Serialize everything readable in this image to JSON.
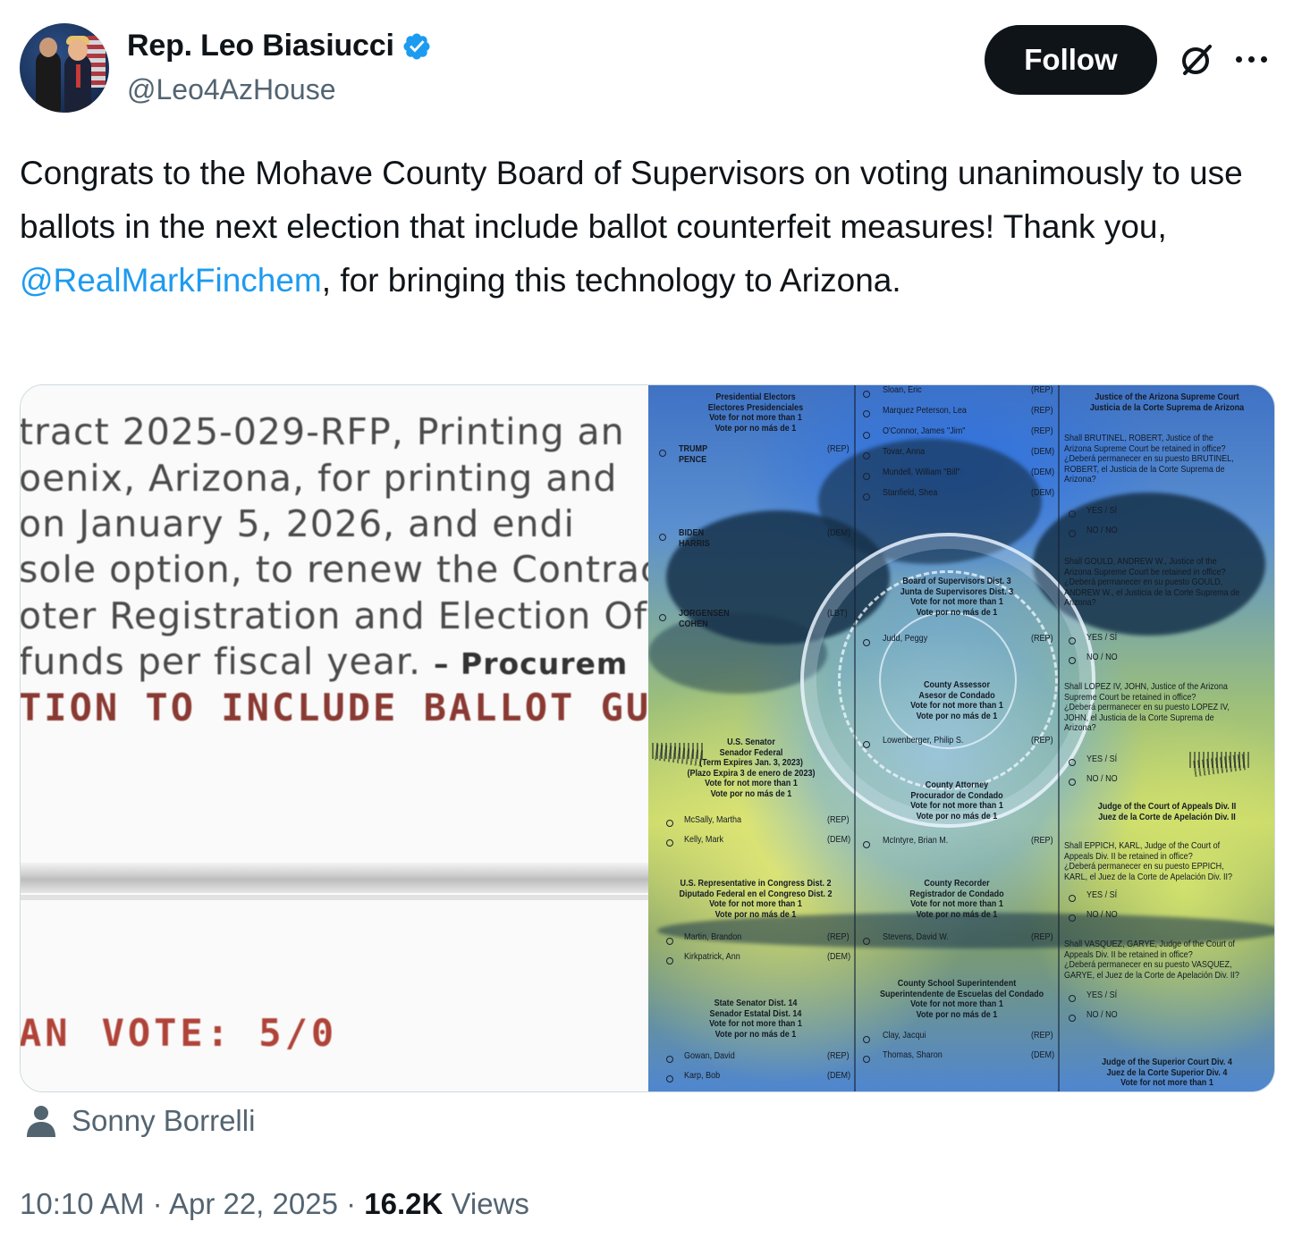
{
  "author": {
    "name": "Rep. Leo Biasiucci",
    "handle": "@Leo4AzHouse",
    "verified_color": "#1d9bf0"
  },
  "actions": {
    "follow_label": "Follow",
    "grok_icon": "grok-icon",
    "more_icon": "more-icon"
  },
  "tweet": {
    "text_before": "Congrats to the Mohave County Board of Supervisors on voting unanimously to use ballots in the next election that include ballot counterfeit measures! Thank you, ",
    "mention": "@RealMarkFinchem",
    "text_after": ", for bringing this technology to Arizona."
  },
  "media": {
    "document_lines": [
      "tract 2025-029-RFP, Printing an",
      "oenix, Arizona, for printing and",
      " on January 5, 2026, and endi",
      "sole option, to renew the Contrac",
      "oter Registration and Election Off",
      " funds per fiscal year."
    ],
    "document_procurement": "– Procurem",
    "document_heading": "TION TO INCLUDE BALLOT GU",
    "document_vote_left": "AN",
    "document_vote": "VOTE: 5/0",
    "ballot": {
      "col1": {
        "h1": [
          "Presidential Electors",
          "Electores Presidenciales",
          "Vote for not more than 1",
          "Vote por no más de 1"
        ],
        "r1": [
          "TRUMP",
          "PENCE"
        ],
        "r1p": "(REP)",
        "r2": [
          "BIDEN",
          "HARRIS"
        ],
        "r2p": "(DEM)",
        "r3": [
          "JORGENSEN",
          "COHEN"
        ],
        "r3p": "(LBT)",
        "h2": [
          "U.S. Senator",
          "Senador Federal",
          "(Term Expires Jan. 3, 2023)",
          "(Plazo Expira 3 de enero de 2023)",
          "Vote for not more than 1",
          "Vote por no más de 1"
        ],
        "s1": "McSally, Martha",
        "s1p": "(REP)",
        "s2": "Kelly, Mark",
        "s2p": "(DEM)",
        "h3": [
          "U.S. Representative in Congress Dist. 2",
          "Diputado Federal en el Congreso Dist. 2",
          "Vote for not more than 1",
          "Vote por no más de 1"
        ],
        "c1": "Martin, Brandon",
        "c1p": "(REP)",
        "c2": "Kirkpatrick, Ann",
        "c2p": "(DEM)",
        "h4": [
          "State Senator Dist. 14",
          "Senador Estatal Dist. 14",
          "Vote for not more than 1",
          "Vote por no más de 1"
        ],
        "t1": "Gowan, David",
        "t1p": "(REP)",
        "t2": "Karp, Bob",
        "t2p": "(DEM)"
      },
      "col2": {
        "names": [
          [
            "Sloan, Eric",
            "(REP)"
          ],
          [
            "Marquez Peterson, Lea",
            "(REP)"
          ],
          [
            "O'Connor, James \"Jim\"",
            "(REP)"
          ],
          [
            "Tovar, Anna",
            "(DEM)"
          ],
          [
            "Mundell, William \"Bill\"",
            "(DEM)"
          ],
          [
            "Stanfield, Shea",
            "(DEM)"
          ]
        ],
        "h1": [
          "Board of Supervisors Dist. 3",
          "Junta de Supervisores Dist. 3",
          "Vote for not more than 1",
          "Vote por no más de 1"
        ],
        "n1": "Judd, Peggy",
        "n1p": "(REP)",
        "h2": [
          "County Assessor",
          "Asesor de Condado",
          "Vote for not more than 1",
          "Vote por no más de 1"
        ],
        "n2": "Lowenberger, Philip S.",
        "n2p": "(REP)",
        "h3": [
          "County Attorney",
          "Procurador de Condado",
          "Vote for not more than 1",
          "Vote por no más de 1"
        ],
        "n3": "McIntyre, Brian M.",
        "n3p": "(REP)",
        "h4": [
          "County Recorder",
          "Registrador de Condado",
          "Vote for not more than 1",
          "Vote por no más de 1"
        ],
        "n4": "Stevens, David W.",
        "n4p": "(REP)",
        "h5": [
          "County School Superintendent",
          "Superintendente de Escuelas del Condado",
          "Vote for not more than 1",
          "Vote por no más de 1"
        ],
        "n5": "Clay, Jacqui",
        "n5p": "(REP)",
        "n6": "Thomas, Sharon",
        "n6p": "(DEM)"
      },
      "col3": {
        "h1": [
          "Justice of the Arizona Supreme Court",
          "Justicia de la Corte Suprema de Arizona"
        ],
        "q1": [
          "Shall BRUTINEL, ROBERT, Justice of the",
          "Arizona Supreme Court be retained in office?",
          "¿Deberá permanecer en su puesto BRUTINEL,",
          "ROBERT, el Justicia de la Corte Suprema de",
          "Arizona?"
        ],
        "q2": [
          "Shall GOULD, ANDREW W., Justice of the",
          "Arizona Supreme Court be retained in office?",
          "¿Deberá permanecer en su puesto GOULD,",
          "ANDREW W., el Justicia de la Corte Suprema de",
          "Arizona?"
        ],
        "q3": [
          "Shall LOPEZ IV, JOHN, Justice of the Arizona",
          "Supreme Court be retained in office?",
          "¿Deberá permanecer en su puesto LOPEZ IV,",
          "JOHN, el Justicia de la Corte Suprema de",
          "Arizona?"
        ],
        "h2": [
          "Judge of the Court of Appeals Div. II",
          "Juez de la Corte de Apelación Div. II"
        ],
        "q4": [
          "Shall EPPICH, KARL, Judge of the Court of",
          "Appeals Div. II be retained in office?",
          "¿Deberá permanecer en su puesto EPPICH,",
          "KARL, el Juez de la Corte de Apelación Div. II?"
        ],
        "q5": [
          "Shall VASQUEZ, GARYE, Judge of the Court of",
          "Appeals Div. II be retained in office?",
          "¿Deberá permanecer en su puesto VASQUEZ,",
          "GARYE, el Juez de la Corte de Apelación Div. II?"
        ],
        "h3": [
          "Judge of the Superior Court Div. 4",
          "Juez de la Corte Superior Div. 4",
          "Vote for not more than 1"
        ],
        "yes": "YES / SÍ",
        "no": "NO / NO"
      }
    }
  },
  "attribution": {
    "icon": "person-icon",
    "name": "Sonny Borrelli"
  },
  "meta": {
    "time": "10:10 AM",
    "sep": " · ",
    "date": "Apr 22, 2025",
    "views_count": "16.2K",
    "views_label": "Views"
  }
}
